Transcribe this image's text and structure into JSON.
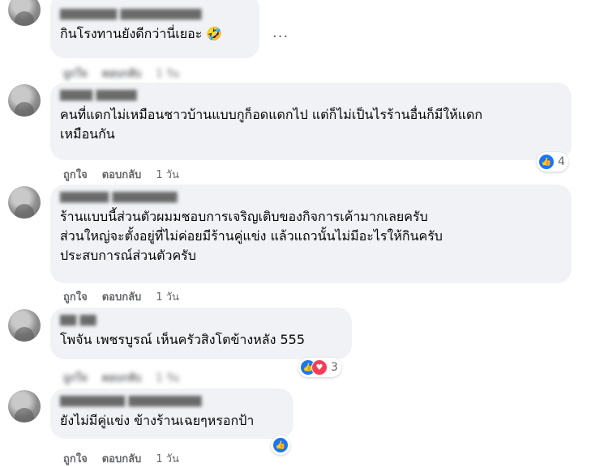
{
  "comments": [
    {
      "author": "▇▇▇▇▇▇▇ ▇▇▇▇▇▇▇▇▇▇",
      "text": "กินโรงทานยังดีกว่านี่เยอะ 🤣",
      "like": "ถูกใจ",
      "reply": "ตอบกลับ",
      "time": "1 วัน",
      "more": "..."
    },
    {
      "author": "▇▇▇▇ ▇▇▇▇▇",
      "text": "คนที่แดกไม่เหมือนชาวบ้านแบบกูก็อดแดกไป แต่ก็ไม่เป็นไรร้านอื่นก็มีให้แดก\nเหมือนกัน",
      "like": "ถูกใจ",
      "reply": "ตอบกลับ",
      "time": "1 วัน",
      "reactions": "4"
    },
    {
      "author": "▇▇▇▇▇▇ ▇▇▇▇▇▇▇▇",
      "text": "ร้านแบบนี้ส่วนตัวผมมชอบการเจริญเติบของกิจการเค้ามากเลยครับ\nส่วนใหญ่จะตั้งอยู่ที่ไม่ค่อยมีร้านคู่แข่ง แล้วแถวนั้นไม่มีอะไรให้กินครับ\nประสบการณ์ส่วนตัวครับ",
      "like": "ถูกใจ",
      "reply": "ตอบกลับ",
      "time": "1 วัน"
    },
    {
      "author": "▇▇ ▇▇",
      "text": "โพจัน เพชรบูรณ์ เห็นครัวสิงโตข้างหลัง 555",
      "like": "ถูกใจ",
      "reply": "ตอบกลับ",
      "time": "1 วัน",
      "reactions": "3"
    },
    {
      "author": "▇▇▇▇▇▇▇▇ ▇▇▇▇▇▇▇▇▇",
      "text": "ยังไม่มีคู่แข่ง ข้างร้านเฉยๆหรอกป้า",
      "like": "ถูกใจ",
      "reply": "ตอบกลับ",
      "time": "1 วัน"
    }
  ],
  "icons": {
    "like": "thumbs-up-icon",
    "love": "heart-icon",
    "more": "ellipsis-icon"
  },
  "colors": {
    "like": "#1877f2",
    "love": "#f33e58",
    "bubble": "#f0f2f5",
    "meta": "#65676b"
  }
}
